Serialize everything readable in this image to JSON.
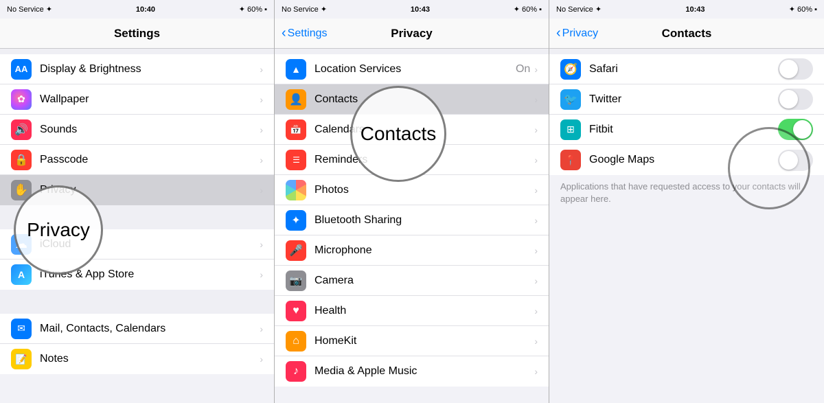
{
  "panel1": {
    "statusBar": {
      "left": "No Service ✦",
      "center": "10:40",
      "right": "✦ 60%"
    },
    "navTitle": "Settings",
    "items": [
      {
        "label": "Display & Brightness",
        "icon": "AA",
        "iconBg": "ic-blue",
        "value": ""
      },
      {
        "label": "Wallpaper",
        "icon": "✿",
        "iconBg": "ic-pink",
        "value": ""
      },
      {
        "label": "Sounds",
        "icon": "🔊",
        "iconBg": "ic-pink",
        "value": ""
      },
      {
        "label": "Passcode",
        "icon": "🔒",
        "iconBg": "ic-red",
        "value": ""
      },
      {
        "label": "Privacy",
        "icon": "✋",
        "iconBg": "ic-gray",
        "value": ""
      },
      {
        "label": "iCloud",
        "icon": "☁",
        "iconBg": "ic-icloud",
        "value": ""
      },
      {
        "label": "iTunes & App Store",
        "icon": "A",
        "iconBg": "ic-appstore",
        "value": ""
      },
      {
        "label": "Mail, Contacts, Calendars",
        "icon": "✉",
        "iconBg": "ic-mail",
        "value": ""
      },
      {
        "label": "Notes",
        "icon": "📝",
        "iconBg": "ic-orange",
        "value": ""
      }
    ],
    "circleLabel": "Privacy",
    "circleItem": 4
  },
  "panel2": {
    "statusBar": {
      "left": "No Service ✦",
      "center": "10:43",
      "right": "✦ 60%"
    },
    "navBack": "Settings",
    "navTitle": "Privacy",
    "items": [
      {
        "label": "Location Services",
        "icon": "▲",
        "iconBg": "ic-blue",
        "value": "On"
      },
      {
        "label": "Contacts",
        "icon": "👤",
        "iconBg": "ic-orange"
      },
      {
        "label": "Calendars",
        "icon": "📅",
        "iconBg": "ic-red"
      },
      {
        "label": "Reminders",
        "icon": "☰",
        "iconBg": "ic-red"
      },
      {
        "label": "Photos",
        "icon": "photos",
        "iconBg": ""
      },
      {
        "label": "Bluetooth Sharing",
        "icon": "✦",
        "iconBg": "ic-bluetooth"
      },
      {
        "label": "Microphone",
        "icon": "🎤",
        "iconBg": "ic-microphone"
      },
      {
        "label": "Camera",
        "icon": "📷",
        "iconBg": "ic-gray"
      },
      {
        "label": "Health",
        "icon": "♥",
        "iconBg": "ic-health"
      },
      {
        "label": "HomeKit",
        "icon": "⌂",
        "iconBg": "ic-homekit"
      },
      {
        "label": "Media & Apple Music",
        "icon": "♪",
        "iconBg": "ic-pink"
      }
    ],
    "circleLabel": "Contacts"
  },
  "panel3": {
    "statusBar": {
      "left": "No Service ✦",
      "center": "10:43",
      "right": "✦ 60%"
    },
    "navBack": "Privacy",
    "navTitle": "Contacts",
    "apps": [
      {
        "label": "Safari",
        "icon": "🧭",
        "iconBg": "ic-blue",
        "toggled": false
      },
      {
        "label": "Twitter",
        "icon": "🐦",
        "iconBg": "ic-teal",
        "toggled": false
      },
      {
        "label": "Fitbit",
        "icon": "⊞",
        "iconBg": "ic-teal",
        "toggled": true
      },
      {
        "label": "Google Maps",
        "icon": "📍",
        "iconBg": "ic-red",
        "toggled": false
      }
    ],
    "helperText": "Applications that have requested access to your contacts will appear here."
  }
}
